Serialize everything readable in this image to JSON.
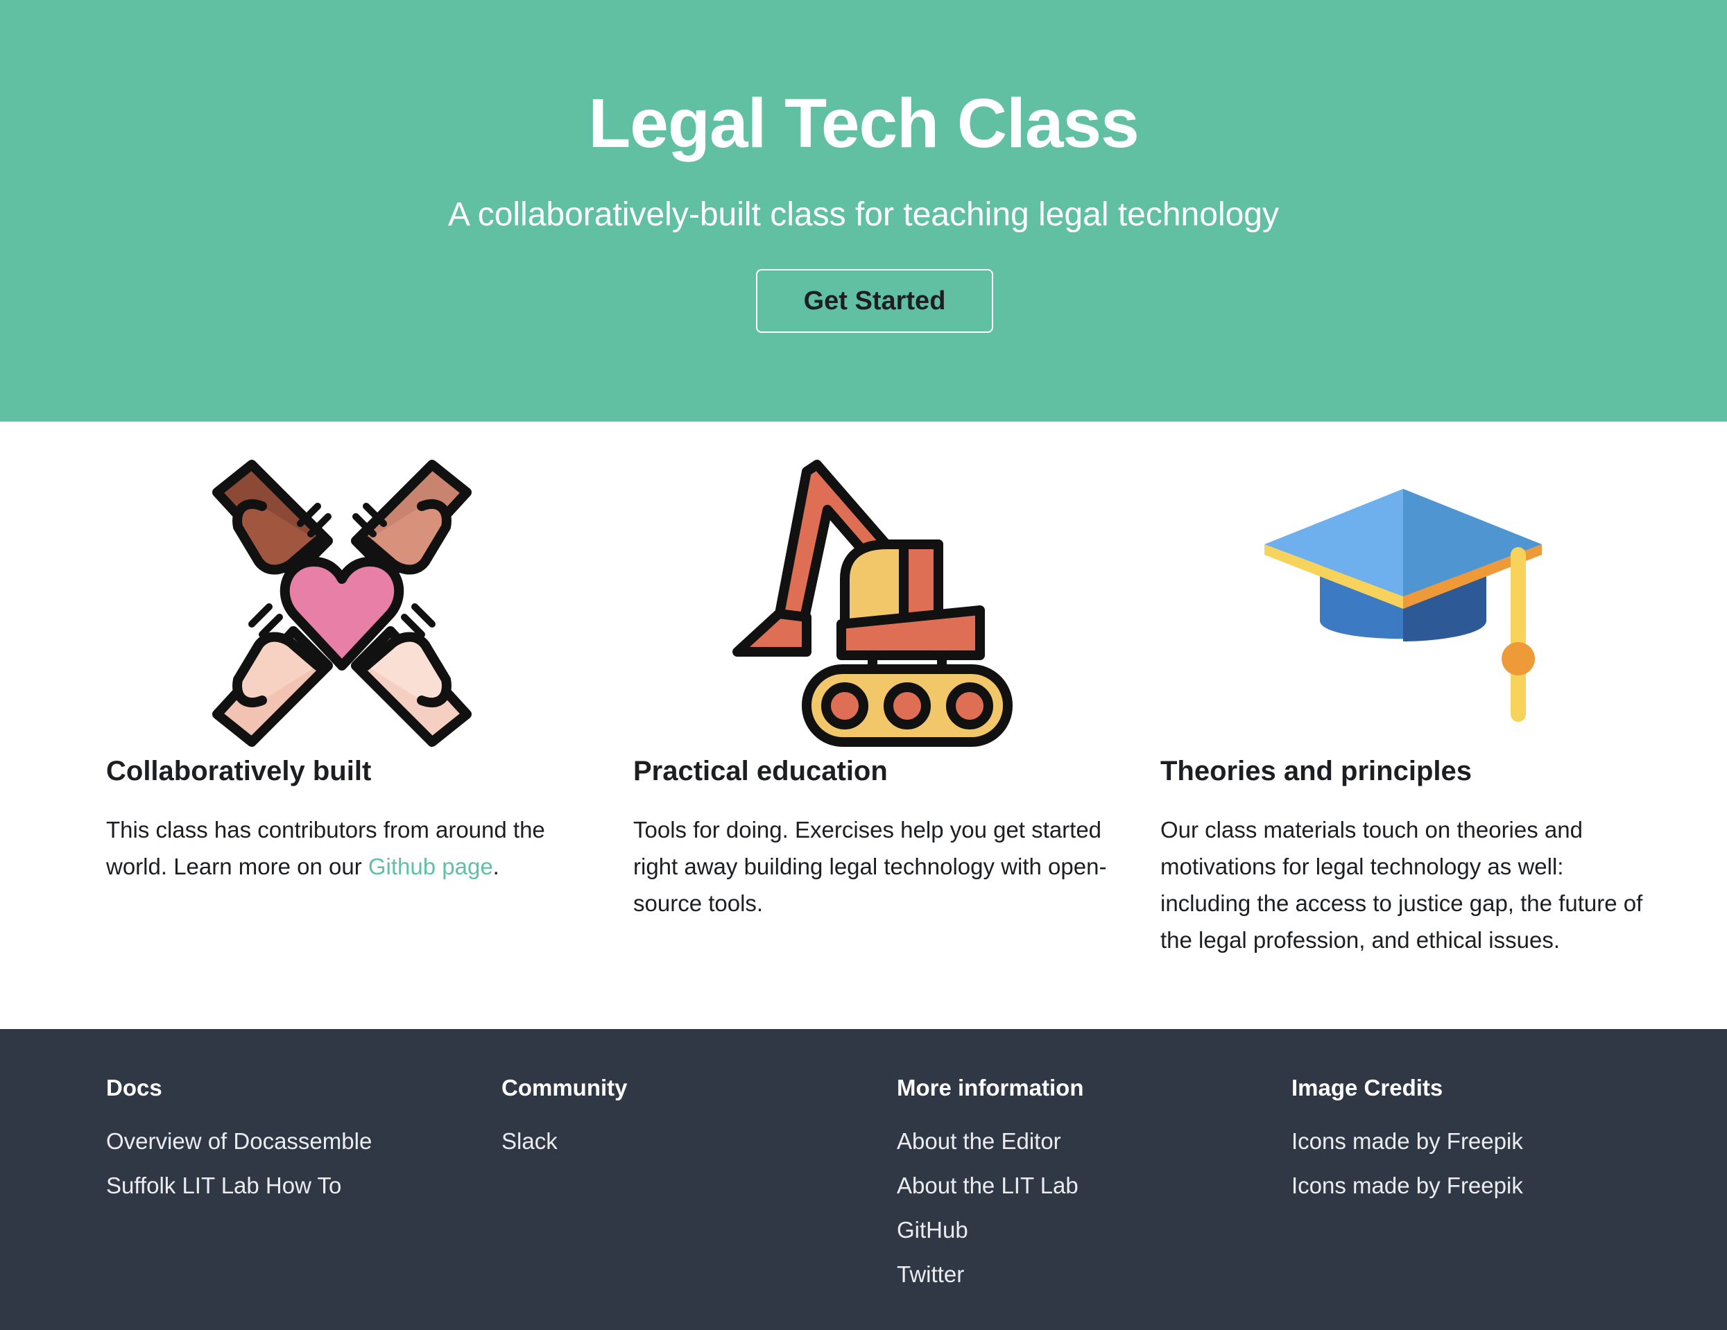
{
  "hero": {
    "title": "Legal Tech Class",
    "subtitle": "A collaboratively-built class for teaching legal technology",
    "cta_label": "Get Started",
    "background_color": "#62c0a2"
  },
  "features": [
    {
      "icon": "hands-heart-icon",
      "title": "Collaboratively built",
      "text_before_link": "This class has contributors from around the world. Learn more on our ",
      "link_label": "Github page",
      "text_after_link": "."
    },
    {
      "icon": "excavator-icon",
      "title": "Practical education",
      "text": "Tools for doing. Exercises help you get started right away building legal technology with open-source tools."
    },
    {
      "icon": "graduation-cap-icon",
      "title": "Theories and principles",
      "text": "Our class materials touch on theories and motivations for legal technology as well: including the access to justice gap, the future of the legal profession, and ethical issues."
    }
  ],
  "footer": {
    "background_color": "#303846",
    "columns": [
      {
        "heading": "Docs",
        "links": [
          "Overview of Docassemble",
          "Suffolk LIT Lab How To"
        ]
      },
      {
        "heading": "Community",
        "links": [
          "Slack"
        ]
      },
      {
        "heading": "More information",
        "links": [
          "About the Editor",
          "About the LIT Lab",
          "GitHub",
          "Twitter"
        ]
      },
      {
        "heading": "Image Credits",
        "links": [
          "Icons made by Freepik",
          "Icons made by Freepik"
        ]
      }
    ]
  },
  "colors": {
    "accent": "#62c0a2",
    "text": "#1c1e21",
    "footer_text": "#ebedf0"
  }
}
